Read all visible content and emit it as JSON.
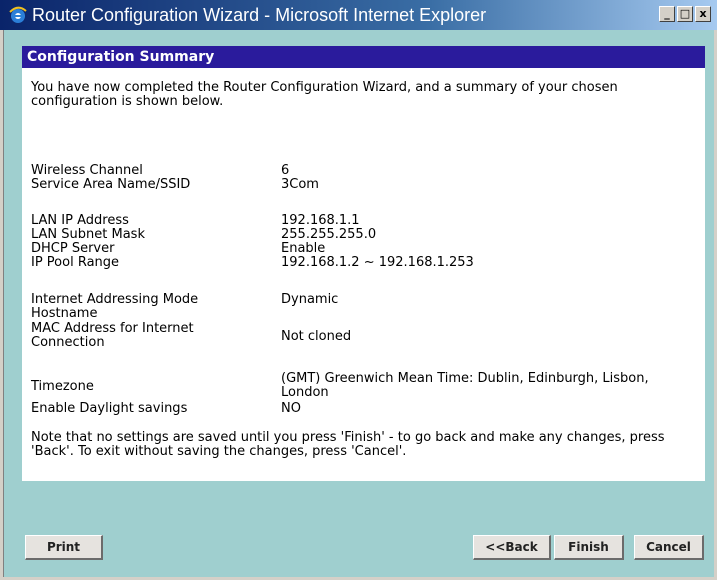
{
  "window": {
    "title": "Router Configuration Wizard - Microsoft Internet Explorer",
    "buttons": {
      "minimize": "_",
      "maximize": "□",
      "close": "x"
    }
  },
  "panel": {
    "header": "Configuration Summary",
    "intro": "You have now completed the Router Configuration Wizard, and a summary of your chosen configuration is shown below.",
    "rows": [
      {
        "label": "Wireless Channel",
        "value": "6"
      },
      {
        "label": "Service Area Name/SSID",
        "value": "3Com"
      },
      {
        "label": "LAN IP Address",
        "value": "192.168.1.1"
      },
      {
        "label": "LAN Subnet Mask",
        "value": "255.255.255.0"
      },
      {
        "label": "DHCP Server",
        "value": "Enable"
      },
      {
        "label": "IP Pool Range",
        "value": "192.168.1.2 ~ 192.168.1.253"
      },
      {
        "label": "Internet Addressing Mode",
        "value": "Dynamic"
      },
      {
        "label": "Hostname",
        "value": ""
      },
      {
        "label": "MAC Address for Internet Connection",
        "value": "Not cloned"
      },
      {
        "label": "Timezone",
        "value": "(GMT) Greenwich Mean Time: Dublin, Edinburgh, Lisbon, London"
      },
      {
        "label": "Enable Daylight savings",
        "value": "NO"
      }
    ],
    "note": "Note that no settings are saved until you press 'Finish' - to go back and make any changes, press 'Back'. To exit without saving the changes, press 'Cancel'."
  },
  "buttons": {
    "print": "Print",
    "back": "<<Back",
    "finish": "Finish",
    "cancel": "Cancel"
  },
  "colors": {
    "header_bg": "#2a1b9c",
    "page_bg": "#9fcfcf",
    "titlebar": "#0a246a"
  }
}
